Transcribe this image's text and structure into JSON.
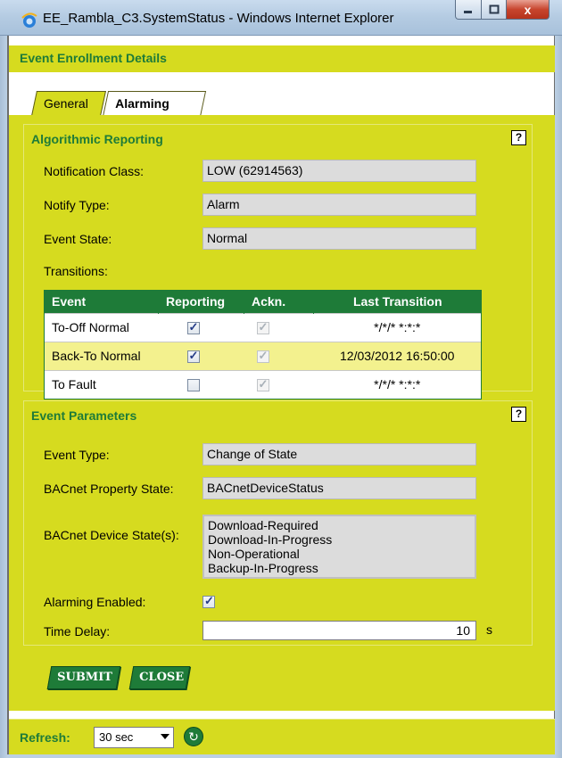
{
  "window": {
    "title": "EE_Rambla_C3.SystemStatus - Windows Internet Explorer",
    "close_glyph": "x"
  },
  "header": {
    "title": "Event Enrollment Details"
  },
  "tabs": [
    {
      "label": "General",
      "active": false
    },
    {
      "label": "Alarming",
      "active": true
    }
  ],
  "algorithmic_reporting": {
    "title": "Algorithmic Reporting",
    "help_glyph": "?",
    "notification_class": {
      "label": "Notification Class:",
      "value": "LOW (62914563)"
    },
    "notify_type": {
      "label": "Notify Type:",
      "value": "Alarm"
    },
    "event_state": {
      "label": "Event State:",
      "value": "Normal"
    },
    "transitions_label": "Transitions:",
    "transitions": {
      "columns": [
        "Event",
        "Reporting",
        "Ackn.",
        "Last Transition"
      ],
      "rows": [
        {
          "event": "To-Off Normal",
          "reporting": true,
          "ackn": true,
          "last_transition": "*/*/* *:*:*"
        },
        {
          "event": "Back-To Normal",
          "reporting": true,
          "ackn": true,
          "last_transition": "12/03/2012 16:50:00"
        },
        {
          "event": "To Fault",
          "reporting": false,
          "ackn": true,
          "last_transition": "*/*/* *:*:*"
        }
      ]
    }
  },
  "event_parameters": {
    "title": "Event Parameters",
    "help_glyph": "?",
    "event_type": {
      "label": "Event Type:",
      "value": "Change of State"
    },
    "property_state": {
      "label": "BACnet Property State:",
      "value": "BACnetDeviceStatus"
    },
    "device_states": {
      "label": "BACnet Device State(s):",
      "values": [
        "Download-Required",
        "Download-In-Progress",
        "Non-Operational",
        "Backup-In-Progress"
      ]
    },
    "alarming_enabled": {
      "label": "Alarming Enabled:",
      "checked": true
    },
    "time_delay": {
      "label": "Time Delay:",
      "value": "10",
      "unit": "s"
    }
  },
  "buttons": {
    "submit": "SUBMIT",
    "close": "CLOSE"
  },
  "refresh": {
    "label": "Refresh:",
    "selected": "30 sec"
  },
  "colors": {
    "accent_yellow": "#d6db1f",
    "accent_green": "#1e7b38",
    "row_highlight": "#f3f18e"
  },
  "icons": [
    "ie-icon",
    "help-icon",
    "refresh-icon",
    "minimize-icon",
    "maximize-icon",
    "close-icon"
  ]
}
